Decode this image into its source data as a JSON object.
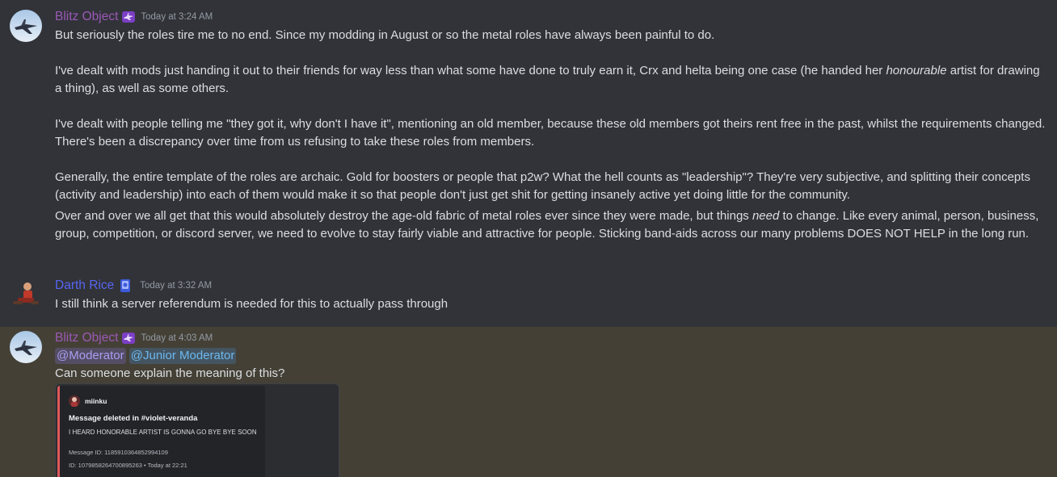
{
  "messages": [
    {
      "author": "Blitz Object",
      "author_color": "#9b59b6",
      "badge_icon": "purple-plane-role-icon",
      "timestamp": "Today at 3:24 AM",
      "paragraphs": {
        "p1": "But seriously the roles tire me to no end. Since my modding in August or so the metal roles have always been painful to do.",
        "p2_before": "I've dealt with mods just handing it out to their friends for way less than what some have done to truly earn it, Crx and helta being one case (he handed her ",
        "p2_em": "honourable",
        "p2_after": " artist for drawing a thing), as well as some others.",
        "p3": "I've dealt with people telling me \"they got it, why don't I have it\", mentioning an old member, because these old members got theirs rent free in the past, whilst the requirements changed. There's been a discrepancy over time from us refusing to take these roles from members.",
        "p4": "Generally, the entire template of the roles are archaic. Gold for boosters or people that p2w? What the hell counts as \"leadership\"? They're very subjective, and splitting their concepts (activity and leadership) into each of them would make it so that people don't just get shit for getting insanely active yet doing little for the community.",
        "p5_before": "Over and over we all get that this would absolutely destroy the age-old fabric of metal roles ever since they were made, but things ",
        "p5_em": "need",
        "p5_after": " to change. Like every animal, person, business, group, competition, or discord server, we need to evolve to stay fairly viable and attractive for people. Sticking band-aids across our many problems DOES NOT HELP in the long run."
      }
    },
    {
      "author": "Darth Rice",
      "author_color": "#5865f2",
      "badge_icon": "blue-card-role-icon",
      "timestamp": "Today at 3:32 AM",
      "text": "I still think a server referendum is needed for this to actually pass through"
    },
    {
      "author": "Blitz Object",
      "author_color": "#9b59b6",
      "badge_icon": "purple-plane-role-icon",
      "timestamp": "Today at 4:03 AM",
      "mention_1": "@Moderator",
      "mention_2": "@Junior Moderator",
      "text": "Can someone explain the meaning of this?",
      "embed": {
        "author": "miinku",
        "title": "Message deleted in #violet-veranda",
        "description": "I HEARD HONORABLE ARTIST IS GONNA GO BYE BYE SOON",
        "message_id": "Message ID: 1185910364852994109",
        "footer": "ID: 1079858264700895263 • Today at 22:21",
        "accent_color": "#e0575b"
      }
    }
  ]
}
